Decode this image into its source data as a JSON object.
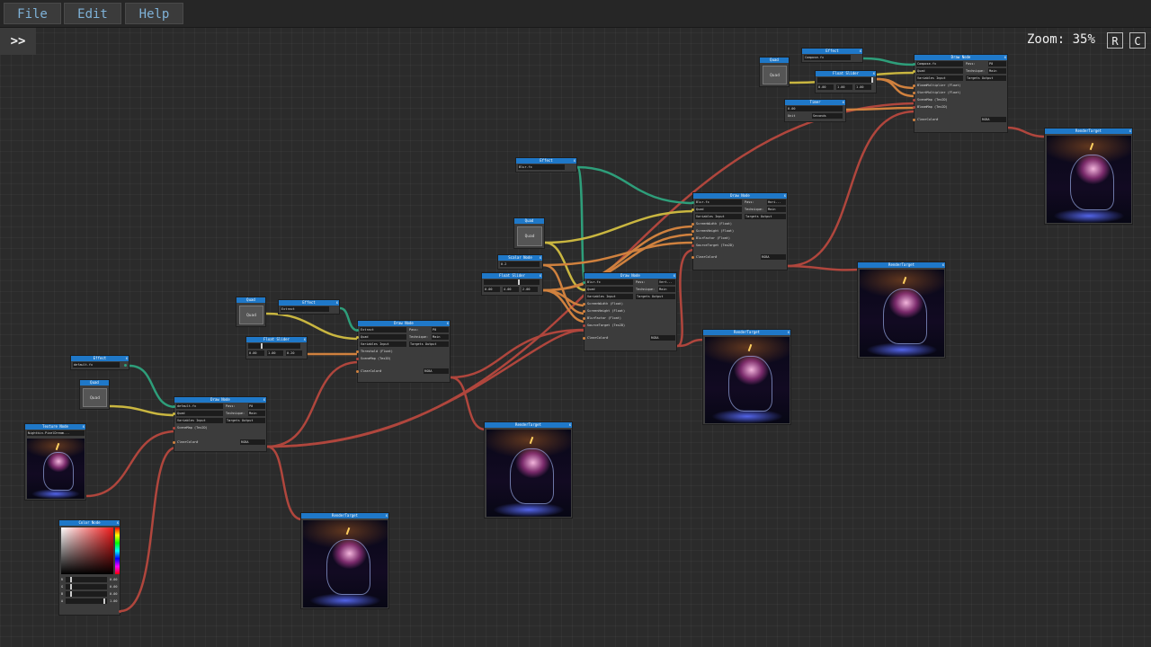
{
  "menu": {
    "file": "File",
    "edit": "Edit",
    "help": "Help"
  },
  "toolbar": {
    "expand": ">>"
  },
  "zoom": {
    "label": "Zoom:",
    "value": "35%",
    "reset": "R",
    "center": "C"
  },
  "colors": {
    "title_bar": "#1f78c8",
    "wire_red": "#b0463d",
    "wire_yellow": "#c9b640",
    "wire_teal": "#2e9e7a",
    "wire_orange": "#d0813e"
  },
  "nodes": {
    "effect1": {
      "title": "Effect",
      "value": "default.fx"
    },
    "quad1": {
      "title": "Quad",
      "button": "Quad"
    },
    "texture": {
      "title": "Texture Node",
      "value": "Nightkin.PixelDream..."
    },
    "color": {
      "title": "Color Node",
      "r": "R",
      "g": "G",
      "b": "B",
      "a": "A",
      "rv": "0.00",
      "gv": "0.00",
      "bv": "0.00",
      "av": "1.00"
    },
    "draw1": {
      "title": "Draw Node",
      "effect": "default.fx",
      "quad": "Quad",
      "variables": "Variables Input",
      "scene": "SceneMap (Tex2D)",
      "clear": "ClearColor#",
      "pass_lbl": "Pass:",
      "pass_val": "P0",
      "tech_lbl": "Technique:",
      "tech_val": "Main",
      "target": "Targets Output",
      "clear_val": "RGBA"
    },
    "rt1": {
      "title": "RenderTarget"
    },
    "quad2": {
      "title": "Quad",
      "button": "Quad"
    },
    "effect2": {
      "title": "Effect",
      "value": "Extract"
    },
    "float1": {
      "title": "Float Slider",
      "v1": "0.00",
      "v2": "1.00",
      "v3": "0.20"
    },
    "draw2": {
      "title": "Draw Node",
      "effect": "Extract",
      "quad": "Quad",
      "variables": "Variables Input",
      "threshold": "Threshold (Float)",
      "scene": "SceneMap (Tex2D)",
      "clear": "ClearColor#",
      "pass_lbl": "Pass:",
      "pass_val": "P0",
      "tech_lbl": "Technique:",
      "tech_val": "Main",
      "target": "Targets Output",
      "clear_val": "RGBA"
    },
    "rt2": {
      "title": "RenderTarget"
    },
    "effect3": {
      "title": "Effect",
      "value": "Blur.fx"
    },
    "quad3": {
      "title": "Quad",
      "button": "Quad"
    },
    "scalar": {
      "title": "Scalar Node",
      "value": "0.2"
    },
    "float2": {
      "title": "Float Slider",
      "v1": "0.00",
      "v2": "4.00",
      "v3": "2.00"
    },
    "draw3": {
      "title": "Draw Node",
      "effect": "Blur.fx",
      "quad": "Quad",
      "variables": "Variables Input",
      "sw": "ScreenWidth (Float)",
      "sh": "ScreenHeight (Float)",
      "bf": "BlurFactor (Float)",
      "st": "SourceTarget (Tex2D)",
      "clear": "ClearColor#",
      "pass_lbl": "Pass:",
      "pass_val": "Vert...",
      "tech_lbl": "Technique:",
      "tech_val": "Main",
      "target": "Targets Output",
      "clear_val": "RGBA"
    },
    "rt3": {
      "title": "RenderTarget"
    },
    "draw4": {
      "title": "Draw Node",
      "effect": "Blur.fx",
      "quad": "Quad",
      "variables": "Variables Input",
      "sw": "ScreenWidth (Float)",
      "sh": "ScreenHeight (Float)",
      "bf": "BlurFactor (Float)",
      "st": "SourceTarget (Tex2D)",
      "clear": "ClearColor#",
      "pass_lbl": "Pass:",
      "pass_val": "Hori...",
      "tech_lbl": "Technique:",
      "tech_val": "Main",
      "target": "Targets Output",
      "clear_val": "RGBA"
    },
    "rt4": {
      "title": "RenderTarget"
    },
    "quad4": {
      "title": "Quad",
      "button": "Quad"
    },
    "effect4": {
      "title": "Effect",
      "value": "Compose.fx"
    },
    "float3": {
      "title": "Float Slider",
      "v1": "0.00",
      "v2": "1.00",
      "v3": "1.00"
    },
    "timer": {
      "title": "Timer",
      "value": "0.00",
      "unit_lbl": "Unit",
      "unit_val": "Seconds"
    },
    "draw5": {
      "title": "Draw Node",
      "effect": "Compose.fx",
      "quad": "Quad",
      "variables": "Variables Input",
      "bm": "BloomMultiplier (Float)",
      "sm": "StartMultiplier (Float)",
      "scene": "SceneMap (Tex2D)",
      "bloom": "BloomMap (Tex2D)",
      "clear": "ClearColor#",
      "pass_lbl": "Pass:",
      "pass_val": "P0",
      "tech_lbl": "Technique:",
      "tech_val": "Main",
      "target": "Targets Output",
      "clear_val": "RGBA"
    },
    "rt5": {
      "title": "RenderTarget"
    }
  }
}
